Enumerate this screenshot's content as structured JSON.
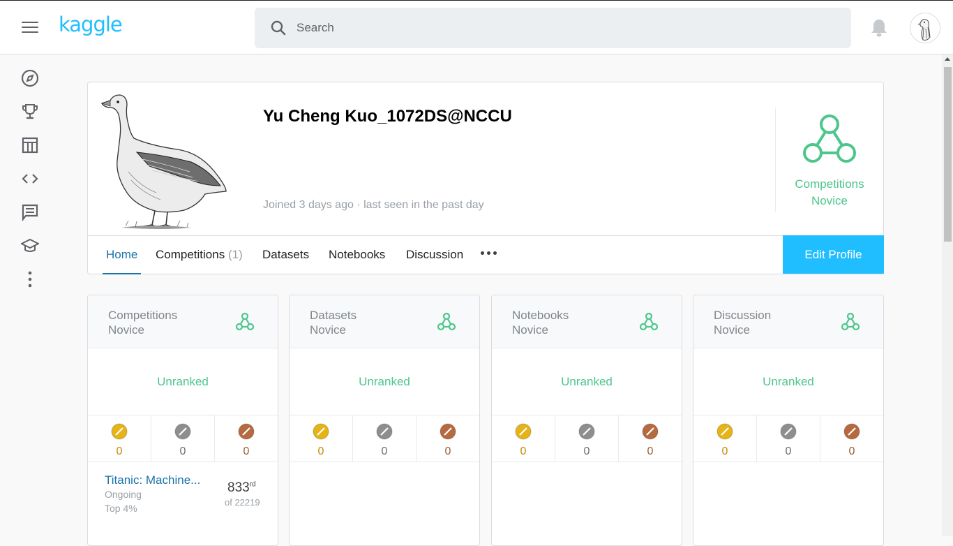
{
  "header": {
    "logo_text": "kaggle",
    "search_placeholder": "Search"
  },
  "sidebar": {
    "items": [
      "compass-icon",
      "trophy-icon",
      "table-icon",
      "code-icon",
      "discussion-icon",
      "school-icon",
      "more-vert-icon"
    ]
  },
  "profile": {
    "name": "Yu Cheng Kuo_1072DS@NCCU",
    "joined": "Joined 3 days ago · last seen in the past day",
    "tier_line1": "Competitions",
    "tier_line2": "Novice",
    "tabs": [
      {
        "label": "Home",
        "count": ""
      },
      {
        "label": "Competitions",
        "count": "(1)"
      },
      {
        "label": "Datasets",
        "count": ""
      },
      {
        "label": "Notebooks",
        "count": ""
      },
      {
        "label": "Discussion",
        "count": ""
      }
    ],
    "edit_label": "Edit Profile"
  },
  "tier_cards": [
    {
      "category": "Competitions",
      "tier": "Novice",
      "rank": "Unranked",
      "gold": "0",
      "silver": "0",
      "bronze": "0"
    },
    {
      "category": "Datasets",
      "tier": "Novice",
      "rank": "Unranked",
      "gold": "0",
      "silver": "0",
      "bronze": "0"
    },
    {
      "category": "Notebooks",
      "tier": "Novice",
      "rank": "Unranked",
      "gold": "0",
      "silver": "0",
      "bronze": "0"
    },
    {
      "category": "Discussion",
      "tier": "Novice",
      "rank": "Unranked",
      "gold": "0",
      "silver": "0",
      "bronze": "0"
    }
  ],
  "competition": {
    "name": "Titanic: Machine...",
    "status": "Ongoing",
    "top": "Top 4%",
    "rank": "833",
    "rank_suffix": "rd",
    "of": "of 22219"
  },
  "colors": {
    "accent": "#20beff",
    "novice": "#4dc68c",
    "gold": "#e6b417",
    "silver": "#8e8e8e",
    "bronze": "#b66a3f",
    "gold_text": "#c28a00",
    "silver_text": "#6b6b6b",
    "bronze_text": "#9a5b36",
    "link": "#1a73a8"
  }
}
